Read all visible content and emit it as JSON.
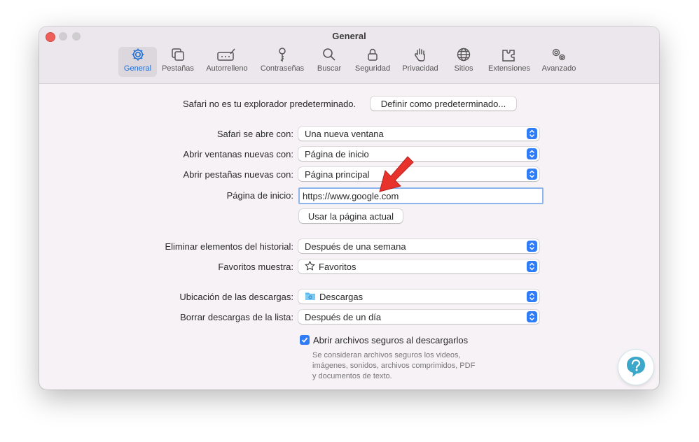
{
  "window": {
    "title": "General"
  },
  "toolbar": [
    {
      "label": "General",
      "icon": "gear-icon",
      "active": true
    },
    {
      "label": "Pestañas",
      "icon": "tabs-icon"
    },
    {
      "label": "Autorrelleno",
      "icon": "autofill-icon"
    },
    {
      "label": "Contraseñas",
      "icon": "key-icon"
    },
    {
      "label": "Buscar",
      "icon": "search-icon"
    },
    {
      "label": "Seguridad",
      "icon": "lock-icon"
    },
    {
      "label": "Privacidad",
      "icon": "hand-icon"
    },
    {
      "label": "Sitios",
      "icon": "globe-icon"
    },
    {
      "label": "Extensiones",
      "icon": "puzzle-icon"
    },
    {
      "label": "Avanzado",
      "icon": "gears-icon"
    }
  ],
  "default_browser": {
    "message": "Safari no es tu explorador predeterminado.",
    "button": "Definir como predeterminado..."
  },
  "settings": {
    "opens_with": {
      "label": "Safari se abre con:",
      "value": "Una nueva ventana"
    },
    "new_windows": {
      "label": "Abrir ventanas nuevas con:",
      "value": "Página de inicio"
    },
    "new_tabs": {
      "label": "Abrir pestañas nuevas con:",
      "value": "Página principal"
    },
    "homepage": {
      "label": "Página de inicio:",
      "value": "https://www.google.com",
      "button": "Usar la página actual"
    },
    "history": {
      "label": "Eliminar elementos del historial:",
      "value": "Después de una semana"
    },
    "favorites": {
      "label": "Favoritos muestra:",
      "value": "Favoritos",
      "icon": "star-icon"
    },
    "downloads_location": {
      "label": "Ubicación de las descargas:",
      "value": "Descargas",
      "icon": "folder-icon"
    },
    "clear_downloads": {
      "label": "Borrar descargas de la lista:",
      "value": "Después de un día"
    },
    "open_safe": {
      "label": "Abrir archivos seguros al descargarlos",
      "checked": true,
      "hint_lines": [
        "Se consideran archivos seguros los videos,",
        "imágenes, sonidos, archivos comprimidos, PDF",
        "y documentos de texto."
      ]
    }
  },
  "colors": {
    "accent": "#2f7cf6",
    "arrow": "#e8322c",
    "close": "#ed5f58"
  }
}
